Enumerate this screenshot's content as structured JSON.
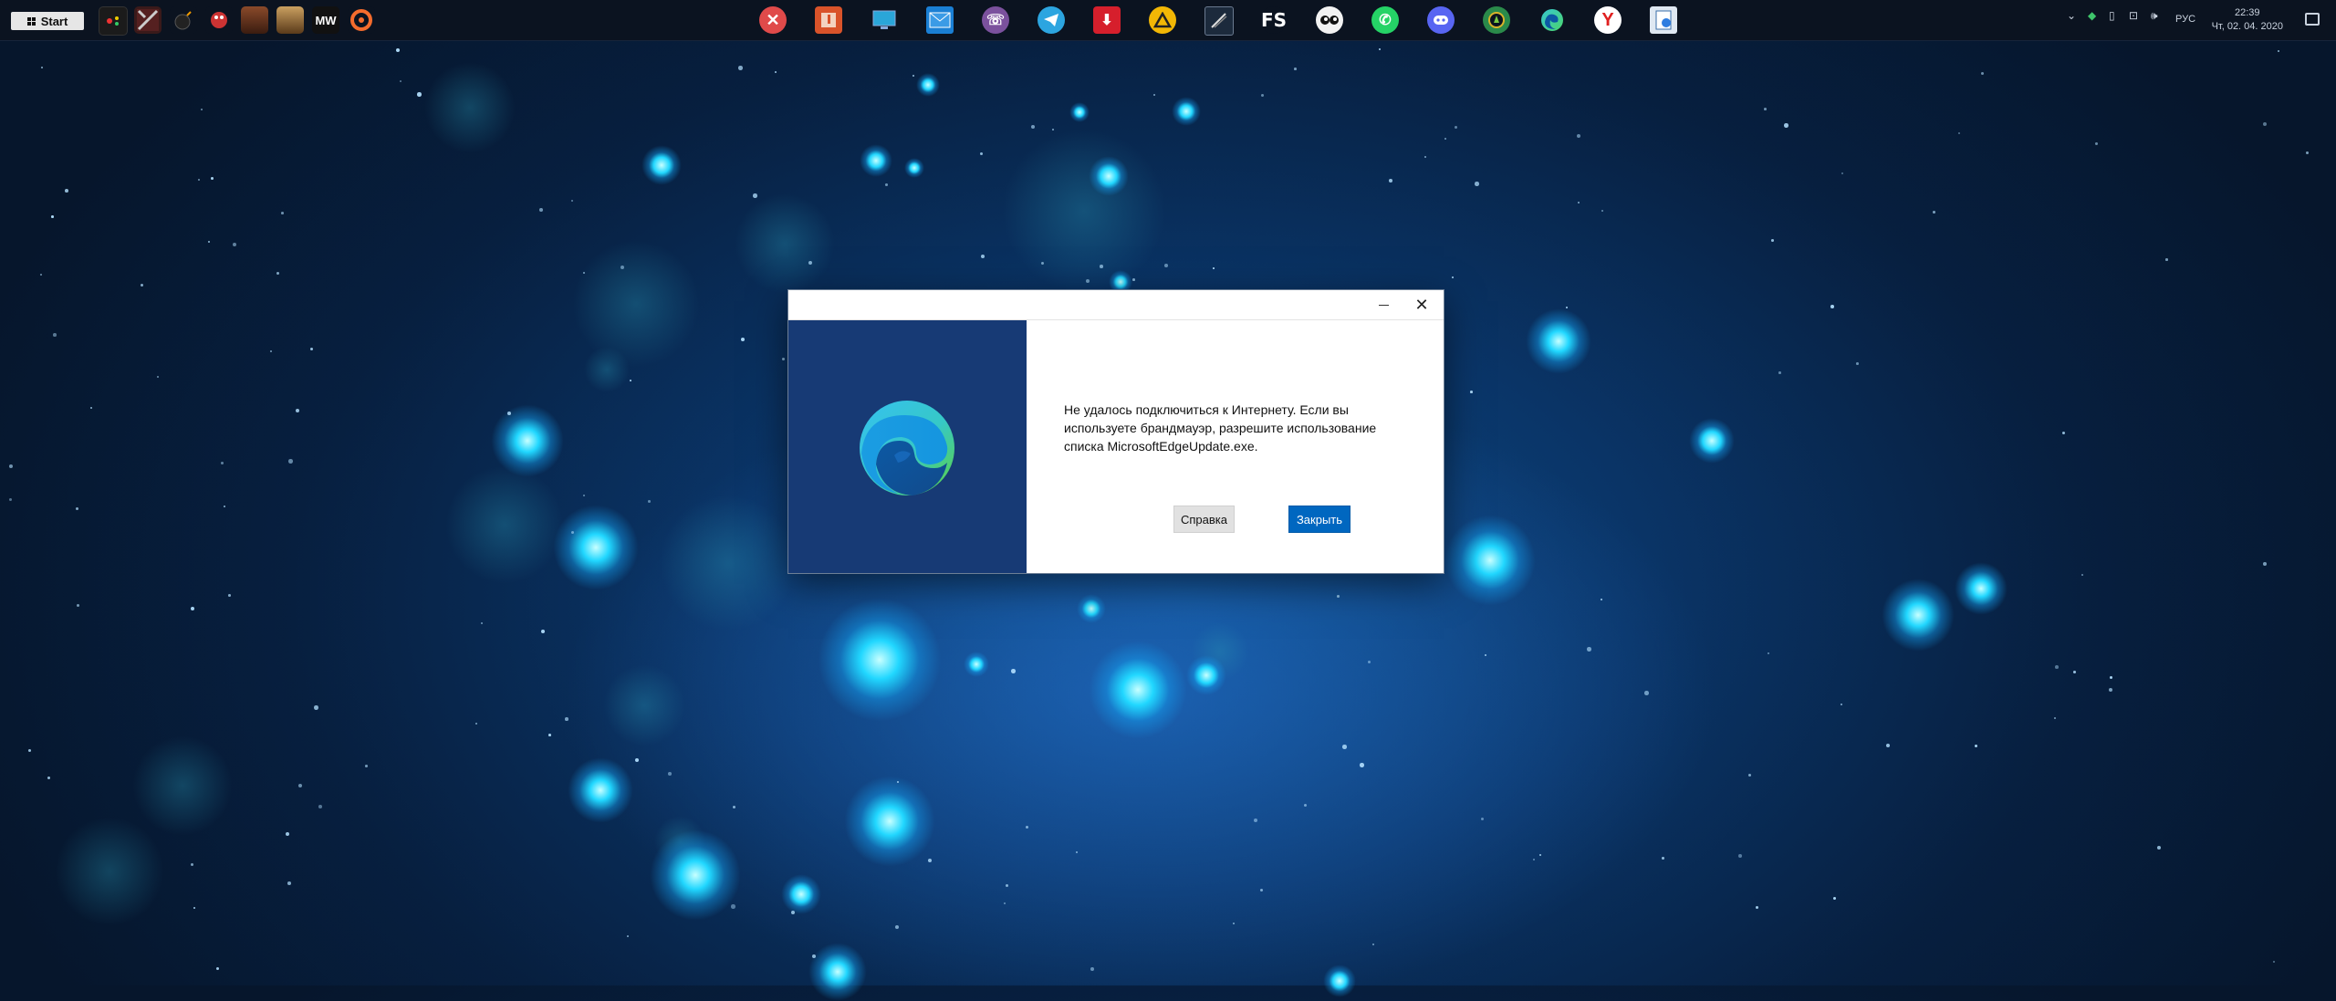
{
  "taskbar": {
    "start_label": "Start",
    "left_apps": [
      {
        "name": "controller-app-icon"
      },
      {
        "name": "dota-icon"
      },
      {
        "name": "bomb-game-icon"
      },
      {
        "name": "worms-game-icon"
      },
      {
        "name": "game-hero-icon"
      },
      {
        "name": "game-warrior-icon"
      },
      {
        "name": "modern-warfare-icon",
        "text": "MW"
      },
      {
        "name": "origin-icon"
      }
    ],
    "center_apps": [
      {
        "name": "close-app-icon"
      },
      {
        "name": "yandex-music-icon"
      },
      {
        "name": "monitor-app-icon"
      },
      {
        "name": "mail-icon"
      },
      {
        "name": "viber-icon"
      },
      {
        "name": "telegram-icon"
      },
      {
        "name": "download-icon"
      },
      {
        "name": "aimp-icon"
      },
      {
        "name": "terminal-app-icon"
      },
      {
        "name": "fs-app-icon",
        "text": "FS"
      },
      {
        "name": "eyes-app-icon"
      },
      {
        "name": "whatsapp-icon"
      },
      {
        "name": "discord-icon"
      },
      {
        "name": "geforce-app-icon"
      },
      {
        "name": "edge-icon"
      },
      {
        "name": "yandex-browser-icon"
      },
      {
        "name": "file-app-icon"
      }
    ],
    "tray": {
      "language": "РУС",
      "time": "22:39",
      "date": "Чт, 02. 04. 2020"
    }
  },
  "dialog": {
    "message_line1": "Не удалось подключиться к Интернету. Если вы",
    "message_line2": "используете брандмауэр, разрешите использование",
    "message_line3": "списка MicrosoftEdgeUpdate.exe.",
    "help_label": "Справка",
    "close_label": "Закрыть"
  },
  "colors": {
    "dialog_side": "#173a75",
    "primary_button": "#0067c0",
    "taskbar": "#0b1320"
  }
}
